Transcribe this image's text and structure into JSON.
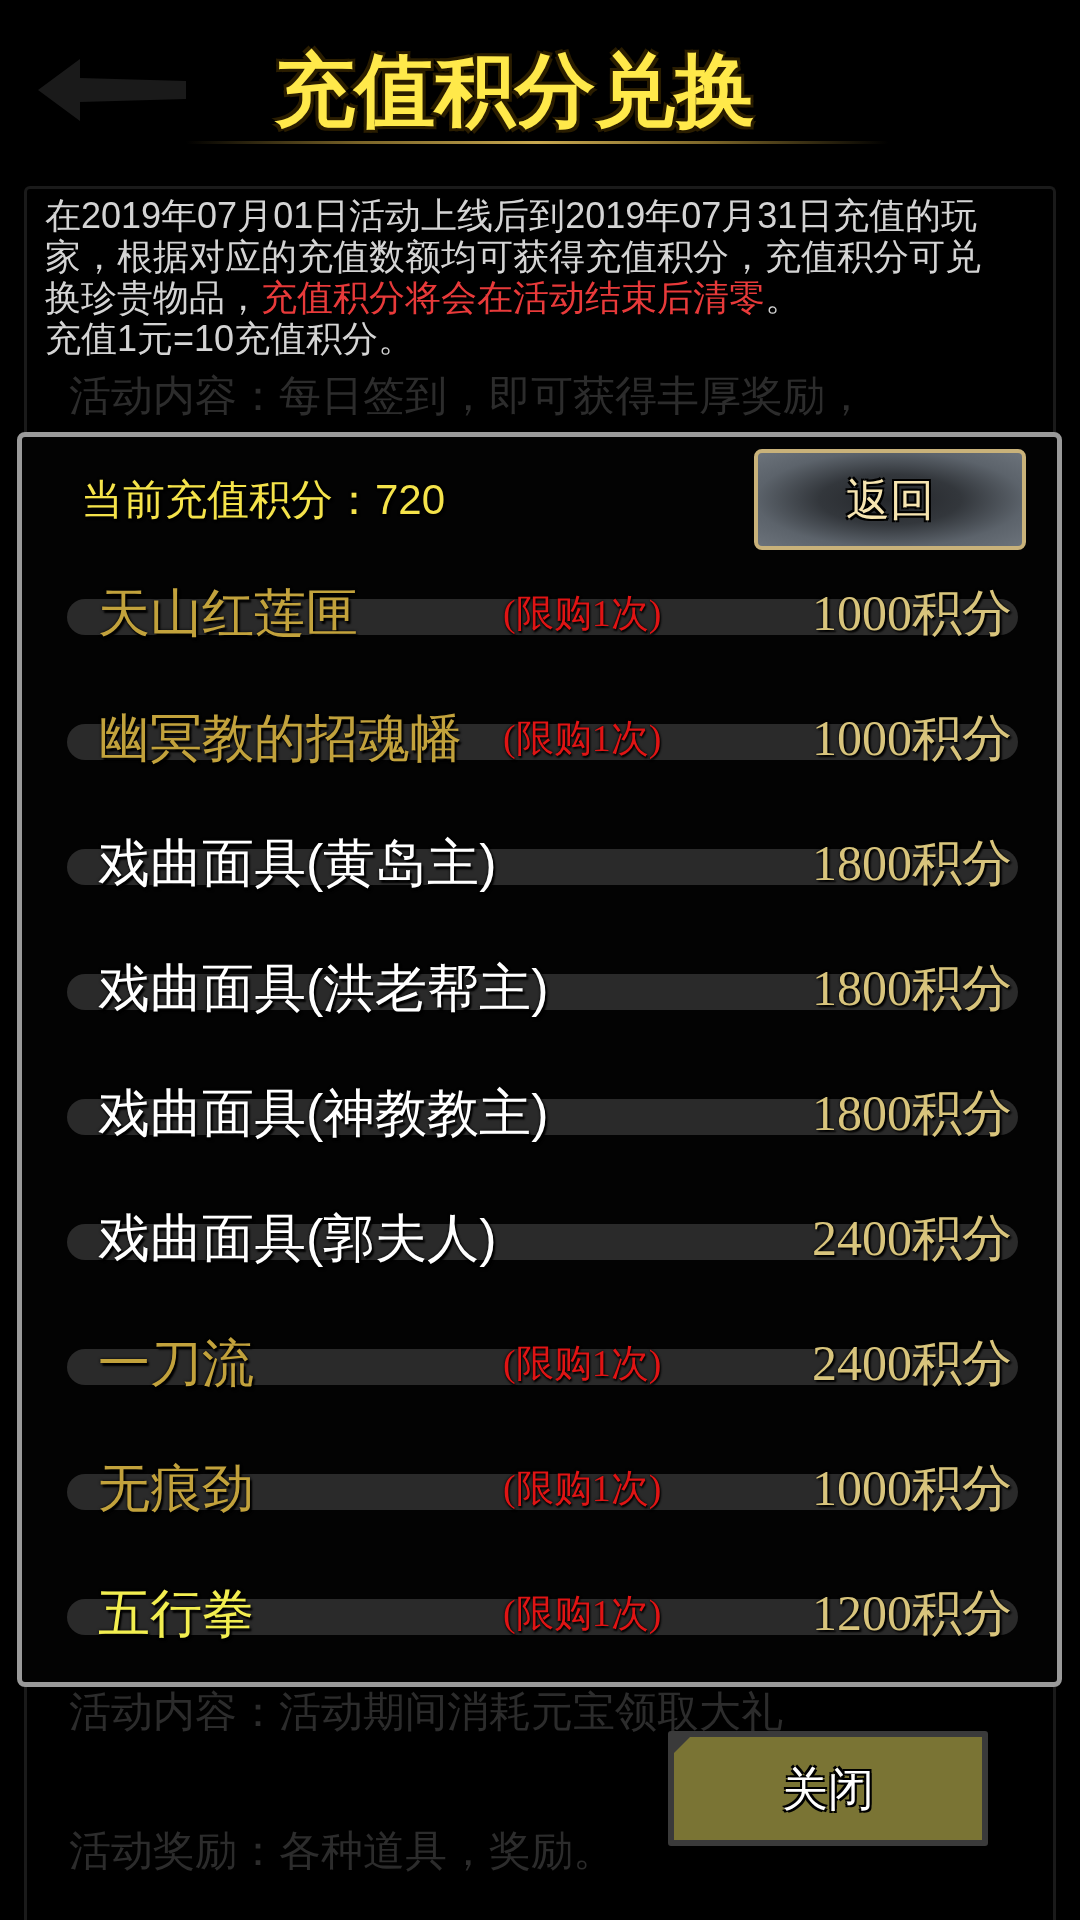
{
  "header": {
    "title": "充值积分兑换"
  },
  "description": {
    "segments": [
      {
        "text": "在2019年07月01日活动上线后到2019年07月31日充值的玩家，根据对应的充值数额均可获得充值积分，充值积分可兑换珍贵物品，",
        "highlight": false
      },
      {
        "text": "充值积分将会在活动结束后清零",
        "highlight": true
      },
      {
        "text": "。",
        "highlight": false
      }
    ],
    "rate_note": "充值1元=10充值积分。"
  },
  "background_line_top": "活动内容：每日签到，即可获得丰厚奖励，",
  "dialog": {
    "points_label": "当前充值积分：720",
    "back_button": "返回",
    "items": [
      {
        "name": "天山红莲匣",
        "kind": "gold",
        "limit": "(限购1次)",
        "price": "1000积分"
      },
      {
        "name": "幽冥教的招魂幡",
        "kind": "gold",
        "limit": "(限购1次)",
        "price": "1000积分"
      },
      {
        "name": "戏曲面具(黄岛主)",
        "kind": "white",
        "price": "1800积分"
      },
      {
        "name": "戏曲面具(洪老帮主)",
        "kind": "white",
        "price": "1800积分"
      },
      {
        "name": "戏曲面具(神教教主)",
        "kind": "white",
        "price": "1800积分"
      },
      {
        "name": "戏曲面具(郭夫人)",
        "kind": "white",
        "price": "2400积分"
      },
      {
        "name": "一刀流",
        "kind": "gold",
        "limit": "(限购1次)",
        "price": "2400积分"
      },
      {
        "name": "无痕劲",
        "kind": "gold",
        "limit": "(限购1次)",
        "price": "1000积分"
      },
      {
        "name": "五行拳",
        "kind": "yellow",
        "limit": "(限购1次)",
        "price": "1200积分"
      }
    ]
  },
  "background_lines_bottom": [
    "活动内容：活动期间消耗元宝领取大礼",
    "活动奖励：各种道具，奖励。"
  ],
  "close_button": "关闭"
}
